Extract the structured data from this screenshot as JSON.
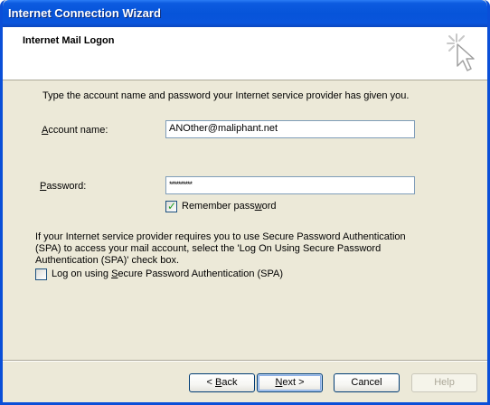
{
  "window": {
    "title": "Internet Connection Wizard"
  },
  "header": {
    "title": "Internet Mail Logon",
    "icon": "wizard-cursor-icon"
  },
  "intro": "Type the account name and password your Internet service provider has given you.",
  "account": {
    "label_prefix": "",
    "label_mnemonic": "A",
    "label_rest": "ccount name:",
    "value": "ANOther@maliphant.net"
  },
  "password": {
    "label_prefix": "",
    "label_mnemonic": "P",
    "label_rest": "assword:",
    "value": "**********"
  },
  "remember": {
    "checked": true,
    "label_prefix": "Remember pass",
    "label_mnemonic": "w",
    "label_rest": "ord"
  },
  "spa_info": "If your Internet service provider requires you to use Secure Password Authentication (SPA) to access your mail account, select the 'Log On Using Secure Password Authentication (SPA)' check box.",
  "spa_checkbox": {
    "checked": false,
    "label_prefix": "Log on using ",
    "label_mnemonic": "S",
    "label_rest": "ecure Password Authentication (SPA)"
  },
  "buttons": {
    "back": {
      "prefix": "< ",
      "mnemonic": "B",
      "rest": "ack"
    },
    "next": {
      "prefix": "",
      "mnemonic": "N",
      "rest": "ext >"
    },
    "cancel": "Cancel",
    "help": "Help"
  },
  "colors": {
    "titlebar": "#0654d9",
    "dialog": "#ece9d8",
    "checkmark": "#21a121"
  }
}
